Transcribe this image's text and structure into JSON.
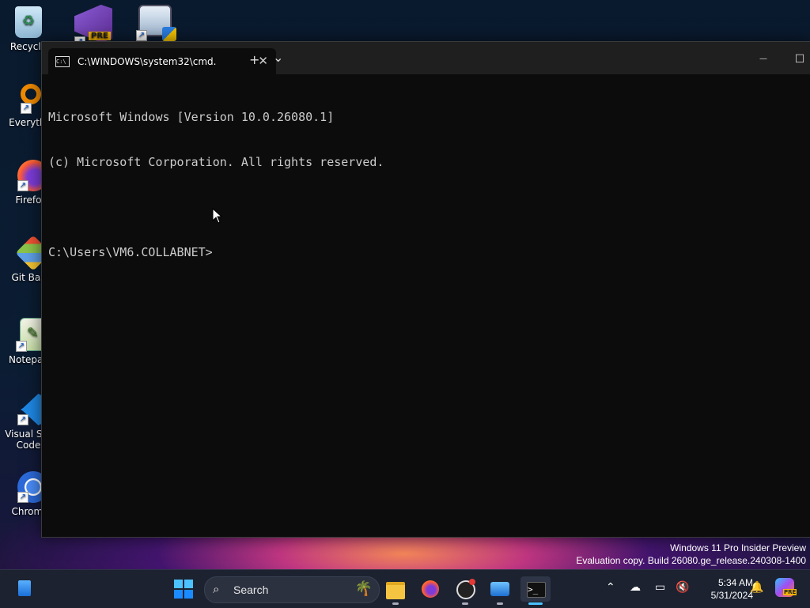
{
  "desktop": {
    "icons": [
      {
        "label": "Recycle"
      },
      {
        "label": ""
      },
      {
        "label": ""
      },
      {
        "label": "Everythi"
      },
      {
        "label": "Firefo"
      },
      {
        "label": "Git Bas"
      },
      {
        "label": "Notepac"
      },
      {
        "label": "Visual Stu Code"
      },
      {
        "label": "Chromi"
      }
    ],
    "vs_badge": "PRE"
  },
  "terminal": {
    "tab_title": "C:\\WINDOWS\\system32\\cmd.",
    "tab_icon_text": "C:\\",
    "close_glyph": "✕",
    "new_tab_glyph": "+",
    "dropdown_glyph": "⌄",
    "minimize_glyph": "—",
    "maximize_glyph": "☐",
    "lines": [
      "Microsoft Windows [Version 10.0.26080.1]",
      "(c) Microsoft Corporation. All rights reserved.",
      "",
      "C:\\Users\\VM6.COLLABNET>"
    ]
  },
  "watermark": {
    "line1": "Windows 11 Pro Insider Preview",
    "line2": "Evaluation copy. Build 26080.ge_release.240308-1400"
  },
  "taskbar": {
    "search_label": "Search",
    "time": "5:34 AM",
    "date": "5/31/2024",
    "copilot_badge": "PRE"
  },
  "colors": {
    "terminal_bg": "#0c0c0c",
    "terminal_text": "#cccccc",
    "taskbar_bg": "#1c2230",
    "windows_blue": "#1a8cff"
  }
}
